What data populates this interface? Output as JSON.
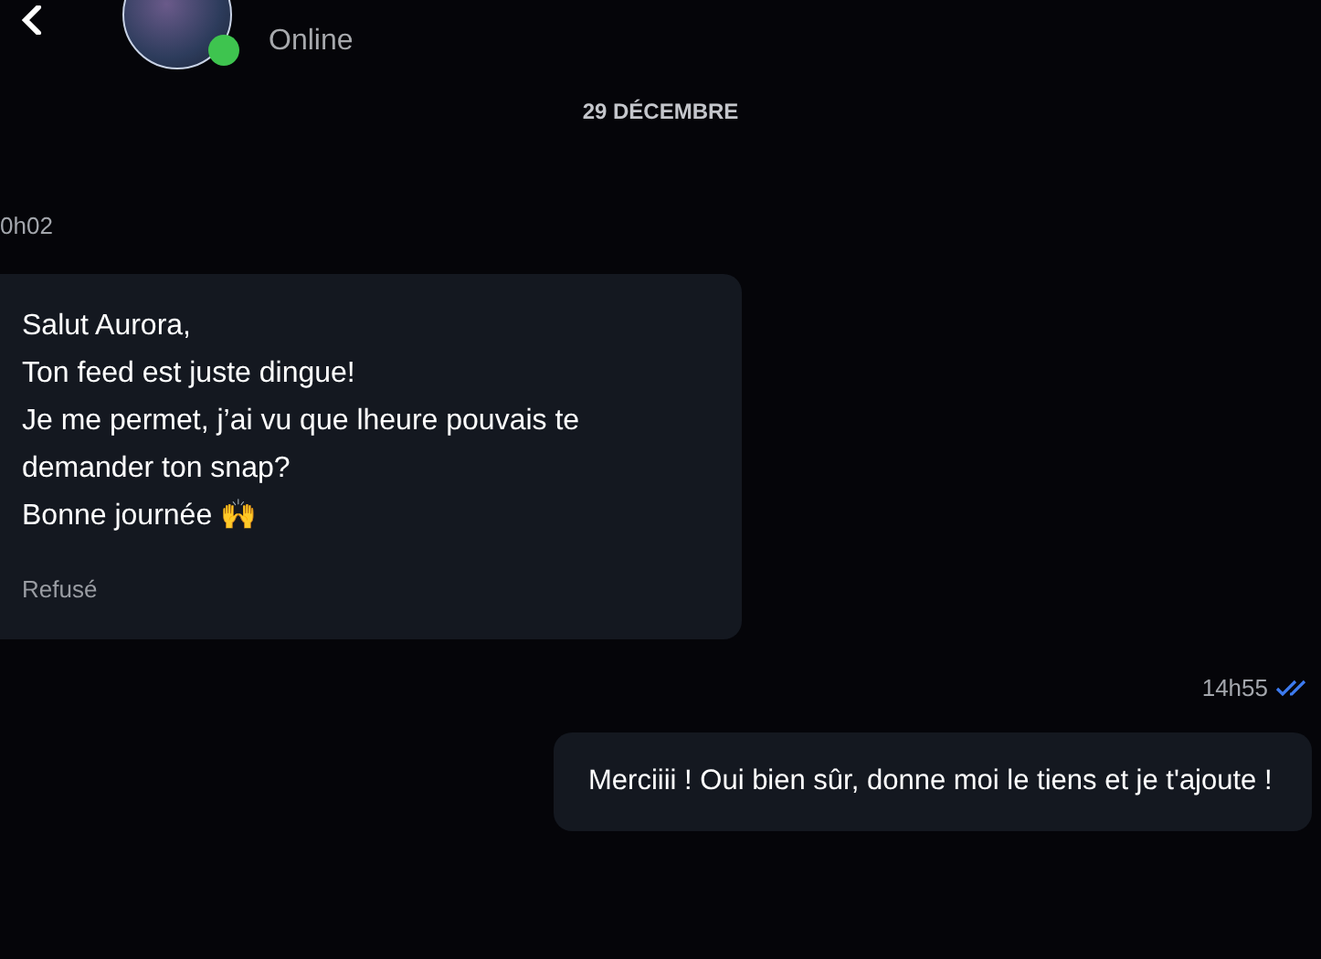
{
  "header": {
    "status": "Online",
    "online": true
  },
  "date_separator": "29 DÉCEMBRE",
  "messages": [
    {
      "kind": "incoming",
      "time": "0h02",
      "lines": [
        "Salut Aurora,",
        "Ton feed est juste dingue!",
        "Je me permet, j’ai vu que lheure pouvais te demander ton snap?",
        "Bonne journée 🙌"
      ],
      "note": "Refusé"
    },
    {
      "kind": "outgoing",
      "time": "14h55",
      "read": true,
      "lines": [
        "Merciiii ! Oui bien sûr, donne moi le tiens et je t'ajoute !"
      ]
    }
  ]
}
